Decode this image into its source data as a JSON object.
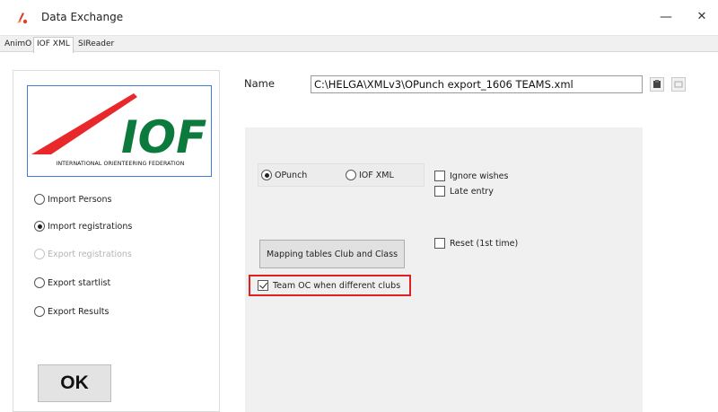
{
  "window": {
    "title": "Data Exchange",
    "minimize_glyph": "—",
    "close_glyph": "✕"
  },
  "tabs": [
    {
      "label": "AnimO"
    },
    {
      "label": "IOF XML"
    },
    {
      "label": "SIReader"
    }
  ],
  "logo": {
    "text": "IOF",
    "caption": "INTERNATIONAL ORIENTEERING FEDERATION",
    "colors": {
      "red": "#e8282b",
      "green": "#0c7a3c",
      "accent": "#3e7ed6"
    }
  },
  "modes": [
    {
      "label": "Import Persons",
      "checked": false,
      "enabled": true
    },
    {
      "label": "Import registrations",
      "checked": true,
      "enabled": true
    },
    {
      "label": "Export registrations",
      "checked": false,
      "enabled": false
    },
    {
      "label": "Export startlist",
      "checked": false,
      "enabled": true
    },
    {
      "label": "Export Results",
      "checked": false,
      "enabled": true
    }
  ],
  "ok_label": "OK",
  "file": {
    "label": "Name",
    "value": "C:\\HELGA\\XMLv3\\OPunch export_1606 TEAMS.xml"
  },
  "format": {
    "options": [
      {
        "label": "OPunch",
        "checked": true
      },
      {
        "label": "IOF XML",
        "checked": false
      }
    ]
  },
  "options": {
    "ignore_wishes": {
      "label": "Ignore wishes",
      "checked": false
    },
    "late_entry": {
      "label": "Late entry",
      "checked": false
    },
    "reset": {
      "label": "Reset (1st time)",
      "checked": false
    },
    "team_oc": {
      "label": "Team OC when different clubs",
      "checked": true
    }
  },
  "mapping_button_label": "Mapping tables Club and Class",
  "highlight_color": "#e02020"
}
